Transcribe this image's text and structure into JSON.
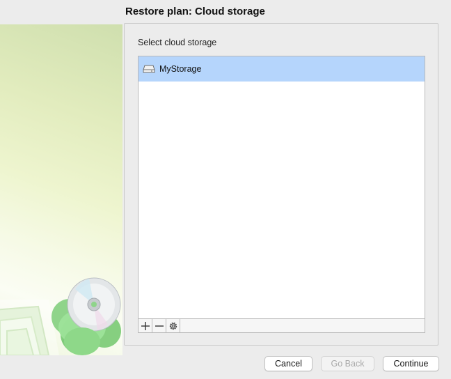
{
  "window": {
    "title": "Restore plan: Cloud storage"
  },
  "panel": {
    "label": "Select cloud storage"
  },
  "storage_list": {
    "items": [
      {
        "label": "MyStorage",
        "icon": "drive-icon",
        "selected": true
      }
    ]
  },
  "toolbar": {
    "icons": [
      "add-icon",
      "remove-icon",
      "gear-icon"
    ]
  },
  "footer": {
    "cancel_label": "Cancel",
    "go_back_label": "Go Back",
    "continue_label": "Continue"
  },
  "colors": {
    "selection": "#b5d5fc",
    "background": "#ececec"
  }
}
